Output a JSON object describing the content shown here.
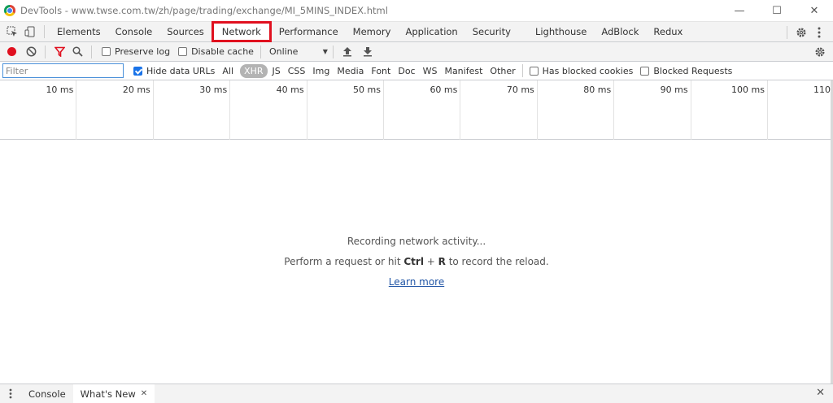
{
  "window": {
    "title": "DevTools - www.twse.com.tw/zh/page/trading/exchange/MI_5MINS_INDEX.html",
    "controls": [
      "—",
      "☐",
      "✕"
    ]
  },
  "tabs": [
    {
      "label": "Elements"
    },
    {
      "label": "Console"
    },
    {
      "label": "Sources"
    },
    {
      "label": "Network"
    },
    {
      "label": "Performance"
    },
    {
      "label": "Memory"
    },
    {
      "label": "Application"
    },
    {
      "label": "Security"
    },
    {
      "label": "Lighthouse"
    },
    {
      "label": "AdBlock"
    },
    {
      "label": "Redux"
    }
  ],
  "active_tab": "Network",
  "toolbar": {
    "preserve_log": "Preserve log",
    "disable_cache": "Disable cache",
    "throttling": "Online"
  },
  "filter": {
    "placeholder": "Filter",
    "hide_data_urls": "Hide data URLs",
    "types": [
      "All",
      "XHR",
      "JS",
      "CSS",
      "Img",
      "Media",
      "Font",
      "Doc",
      "WS",
      "Manifest",
      "Other"
    ],
    "selected_type": "XHR",
    "has_blocked_cookies": "Has blocked cookies",
    "blocked_requests": "Blocked Requests"
  },
  "timeline": {
    "ticks": [
      "10 ms",
      "20 ms",
      "30 ms",
      "40 ms",
      "50 ms",
      "60 ms",
      "70 ms",
      "80 ms",
      "90 ms",
      "100 ms",
      "110"
    ]
  },
  "empty_state": {
    "recording": "Recording network activity...",
    "hint_prefix": "Perform a request or hit ",
    "hint_key1": "Ctrl",
    "hint_plus": " + ",
    "hint_key2": "R",
    "hint_suffix": " to record the reload.",
    "learn_more": "Learn more"
  },
  "drawer": {
    "tabs": [
      {
        "label": "Console"
      },
      {
        "label": "What's New"
      }
    ]
  },
  "colors": {
    "record": "#e0101f",
    "active_tab_highlight": "#e0101f",
    "link": "#2256a6"
  }
}
